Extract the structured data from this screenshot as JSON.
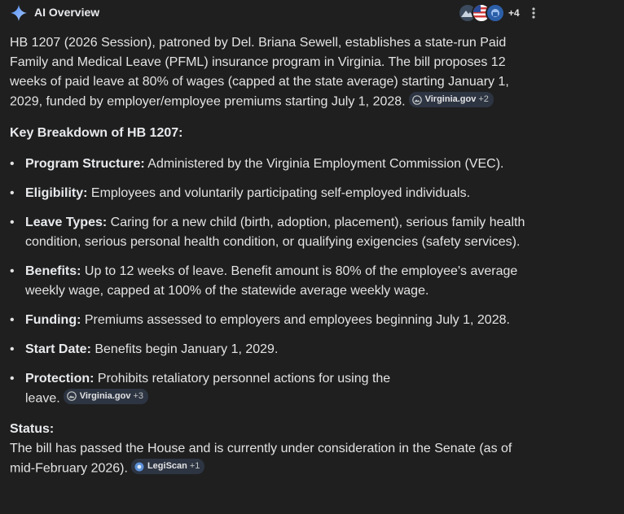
{
  "header": {
    "title": "AI Overview",
    "source_count": "+4",
    "spark_color": "#8ab4f8"
  },
  "intro": {
    "text": "HB 1207 (2026 Session), patroned by Del. Briana Sewell, establishes a state-run Paid Family and Medical Leave (PFML) insurance program in Virginia. The bill proposes 12 weeks of paid leave at 80% of wages (capped at the state average) starting January 1, 2029, funded by employer/employee premiums starting July 1, 2028.",
    "chip": {
      "label": "Virginia.gov",
      "more": "+2"
    }
  },
  "breakdown": {
    "title": "Key Breakdown of HB 1207:",
    "items": [
      {
        "label": "Program Structure:",
        "text": " Administered by the Virginia Employment Commission (VEC)."
      },
      {
        "label": "Eligibility:",
        "text": " Employees and voluntarily participating self-employed individuals."
      },
      {
        "label": "Leave Types:",
        "text": " Caring for a new child (birth, adoption, placement), serious family health condition, serious personal health condition, or qualifying exigencies (safety services)."
      },
      {
        "label": "Benefits:",
        "text": " Up to 12 weeks of leave. Benefit amount is 80% of the employee's average weekly wage, capped at 100% of the statewide average weekly wage."
      },
      {
        "label": "Funding:",
        "text": " Premiums assessed to employers and employees beginning July 1, 2028."
      },
      {
        "label": "Start Date:",
        "text": " Benefits begin January 1, 2029."
      },
      {
        "label": "Protection:",
        "text": " Prohibits retaliatory personnel actions for using the leave.",
        "chip": {
          "label": "Virginia.gov",
          "more": "+3"
        }
      }
    ]
  },
  "status": {
    "title": "Status:",
    "text": "The bill has passed the House and is currently under consideration in the Senate (as of mid-February 2026).",
    "chip": {
      "label": "LegiScan",
      "more": "+1"
    }
  },
  "colors": {
    "background": "#1f1f1f",
    "text": "#e3e3e3",
    "chip_bg": "#2d3442"
  }
}
